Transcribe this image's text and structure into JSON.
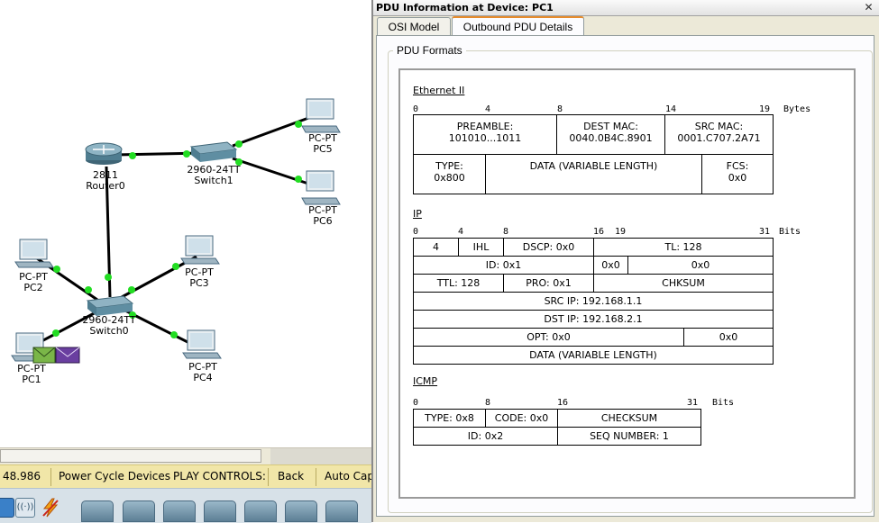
{
  "workspace": {
    "devices": {
      "router0": {
        "model": "2811",
        "name": "Router0"
      },
      "switch1": {
        "model": "2960-24TT",
        "name": "Switch1"
      },
      "switch0": {
        "model": "2960-24TT",
        "name": "Switch0"
      },
      "pc5": {
        "model": "PC-PT",
        "name": "PC5"
      },
      "pc6": {
        "model": "PC-PT",
        "name": "PC6"
      },
      "pc2": {
        "model": "PC-PT",
        "name": "PC2"
      },
      "pc3": {
        "model": "PC-PT",
        "name": "PC3"
      },
      "pc1": {
        "model": "PC-PT",
        "name": "PC1"
      },
      "pc4": {
        "model": "PC-PT",
        "name": "PC4"
      }
    },
    "link_color": "#000000",
    "link_port_color": "#22dd22",
    "pdu_colors": [
      "#7ab648",
      "#6a3fa0"
    ]
  },
  "statusbar": {
    "time": "48.986",
    "power_cycle": "Power Cycle Devices",
    "play_controls": "PLAY CONTROLS:",
    "back": "Back",
    "auto_capture": "Auto Cap"
  },
  "pdu_window": {
    "title": "PDU Information at Device: PC1",
    "close": "✕",
    "tabs": [
      "OSI Model",
      "Outbound PDU Details"
    ],
    "active_tab": "Outbound PDU Details",
    "group_label": "PDU Formats",
    "ethernet": {
      "title": "Ethernet II",
      "ruler": [
        "0",
        "4",
        "8",
        "14",
        "19"
      ],
      "unit": "Bytes",
      "preamble_label": "PREAMBLE:",
      "preamble_value": "101010...1011",
      "dest_mac_label": "DEST MAC:",
      "dest_mac_value": "0040.0B4C.8901",
      "src_mac_label": "SRC MAC:",
      "src_mac_value": "0001.C707.2A71",
      "type_label": "TYPE:",
      "type_value": "0x800",
      "data": "DATA (VARIABLE LENGTH)",
      "fcs_label": "FCS:",
      "fcs_value": "0x0"
    },
    "ip": {
      "title": "IP",
      "ruler": [
        "0",
        "4",
        "8",
        "16",
        "19",
        "31"
      ],
      "unit": "Bits",
      "version": "4",
      "ihl": "IHL",
      "dscp": "DSCP: 0x0",
      "tl": "TL: 128",
      "id": "ID: 0x1",
      "flags": "0x0",
      "frag": "0x0",
      "ttl": "TTL: 128",
      "pro": "PRO: 0x1",
      "chksum": "CHKSUM",
      "src_ip": "SRC IP: 192.168.1.1",
      "dst_ip": "DST IP: 192.168.2.1",
      "opt": "OPT: 0x0",
      "opt_pad": "0x0",
      "data": "DATA (VARIABLE LENGTH)"
    },
    "icmp": {
      "title": "ICMP",
      "ruler": [
        "0",
        "8",
        "16",
        "31"
      ],
      "unit": "Bits",
      "type": "TYPE: 0x8",
      "code": "CODE: 0x0",
      "checksum": "CHECKSUM",
      "id": "ID: 0x2",
      "seq": "SEQ NUMBER: 1"
    }
  }
}
